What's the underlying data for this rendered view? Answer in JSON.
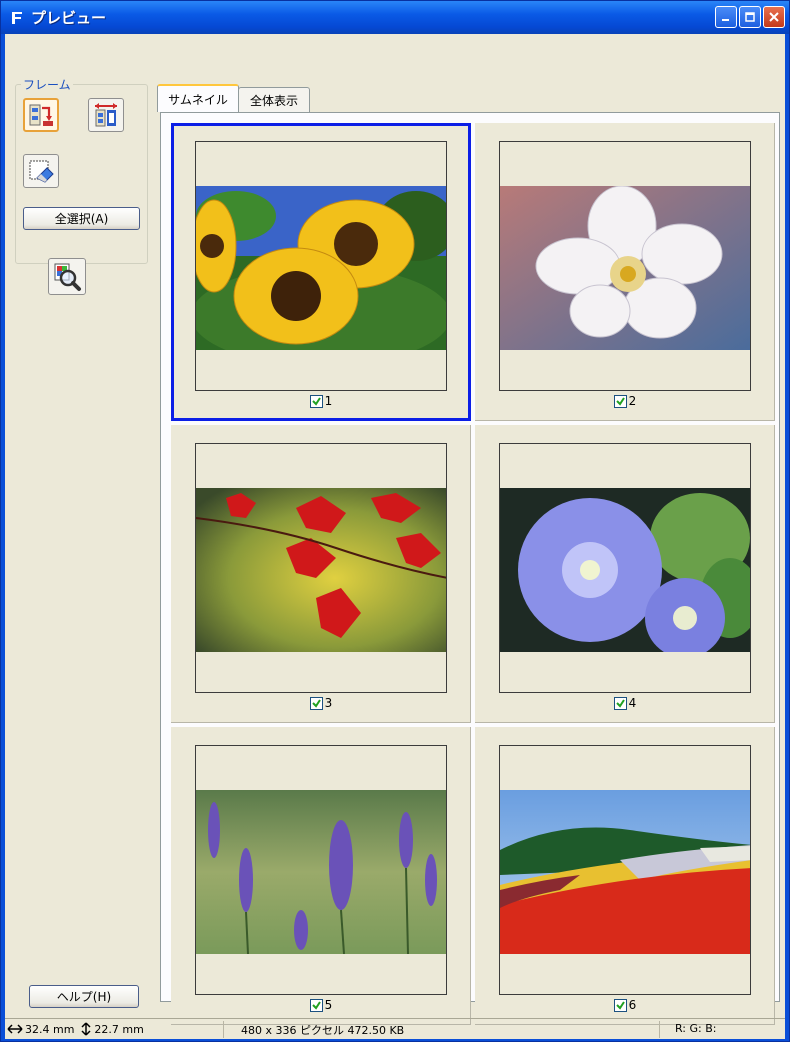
{
  "window": {
    "title": "プレビュー"
  },
  "left_panel": {
    "frame_label": "フレーム",
    "select_all_label": "全選択(A)",
    "help_label": "ヘルプ(H)"
  },
  "tabs": [
    {
      "label": "サムネイル",
      "active": true
    },
    {
      "label": "全体表示",
      "active": false
    }
  ],
  "thumbnails": [
    {
      "number": "1",
      "checked": true,
      "selected": true,
      "subject": "sunflowers"
    },
    {
      "number": "2",
      "checked": true,
      "selected": false,
      "subject": "white-blossom"
    },
    {
      "number": "3",
      "checked": true,
      "selected": false,
      "subject": "red-maple-leaves"
    },
    {
      "number": "4",
      "checked": true,
      "selected": false,
      "subject": "morning-glory"
    },
    {
      "number": "5",
      "checked": true,
      "selected": false,
      "subject": "lavender"
    },
    {
      "number": "6",
      "checked": true,
      "selected": false,
      "subject": "flower-field"
    }
  ],
  "status": {
    "width": "32.4 mm",
    "height": "22.7 mm",
    "info": "480 x 336 ピクセル 472.50 KB",
    "rgb": "R: G: B:"
  },
  "colors": {
    "selection": "#0b1ee6",
    "window_bg": "#ece9d8",
    "titlebar": "#0a5ae6"
  }
}
